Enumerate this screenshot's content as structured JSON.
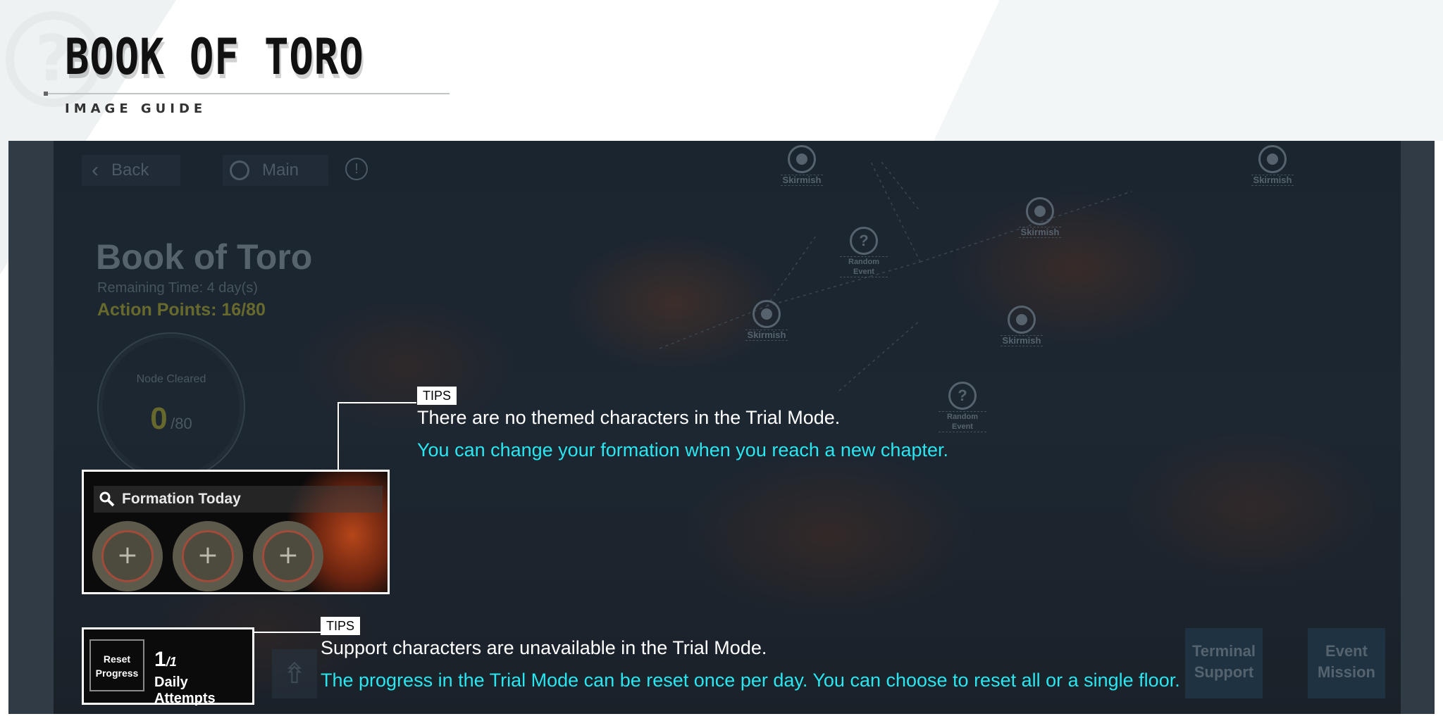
{
  "header": {
    "title": "BOOK OF TORO",
    "subtitle": "IMAGE GUIDE"
  },
  "game": {
    "nav": {
      "back_label": "Back",
      "main_label": "Main",
      "info_glyph": "!"
    },
    "event_title": "Book of Toro",
    "remaining_time": "Remaining Time: 4 day(s)",
    "action_points": "Action Points: 16/80",
    "node_cleared": {
      "label": "Node Cleared",
      "value": "0",
      "total": "/80"
    },
    "nodes": [
      {
        "label": "Skirmish",
        "kind": "skirmish"
      },
      {
        "label": "Skirmish",
        "kind": "skirmish"
      },
      {
        "label": "Skirmish",
        "kind": "skirmish"
      },
      {
        "label": "Random Event",
        "kind": "random"
      },
      {
        "label": "Skirmish",
        "kind": "skirmish"
      },
      {
        "label": "Skirmish",
        "kind": "skirmish"
      },
      {
        "label": "Random Event",
        "kind": "random"
      }
    ],
    "formation": {
      "title": "Formation Today",
      "slots": [
        "+",
        "+",
        "+"
      ]
    },
    "reset": {
      "button": "Reset Progress",
      "count": "1",
      "count_suffix": "/1",
      "label": "Daily Attempts"
    },
    "bottom_buttons": {
      "terminal": "Terminal Support",
      "event": "Event Mission"
    }
  },
  "tips": [
    {
      "badge": "TIPS",
      "line1": "There are no themed characters in the Trial Mode.",
      "line2": "You can change your formation when you reach a new chapter."
    },
    {
      "badge": "TIPS",
      "line1": "Support characters are unavailable in the Trial Mode.",
      "line2": "The progress in the Trial Mode can be reset once per day. You can choose to reset all or a single floor."
    }
  ],
  "colors": {
    "tip_cyan": "#29e6f0",
    "action_points": "#676a2c"
  }
}
